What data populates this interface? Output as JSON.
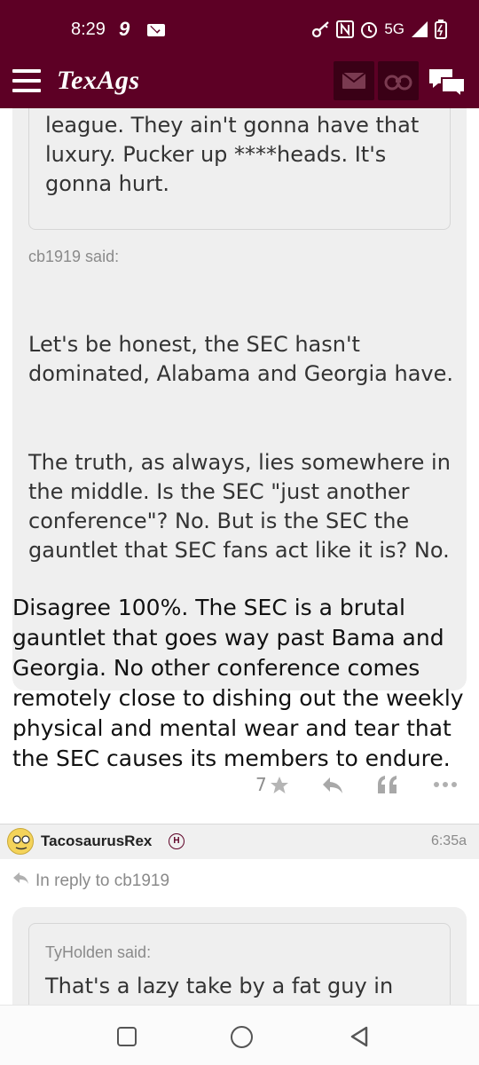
{
  "status_bar": {
    "time": "8:29",
    "notification_number": "9",
    "network": "5G",
    "icons": [
      "mail-icon",
      "key-icon",
      "nfc-icon",
      "alarm-icon",
      "signal-icon",
      "battery-icon"
    ]
  },
  "header": {
    "logo": "TexAgs",
    "icons": [
      "menu-icon",
      "mail-icon",
      "binoculars-icon",
      "chat-icon"
    ],
    "brand_color": "#5d0025"
  },
  "post1": {
    "nested_quote_text": "supporting him when we joined the league. They ain't gonna have that luxury. Pucker up ****heads. It's gonna hurt.",
    "quote_said": "cb1919 said:",
    "quote_para1": "Let's be honest, the SEC hasn't dominated, Alabama and Georgia have.",
    "quote_para2": "The truth, as always, lies somewhere in the middle. Is the SEC \"just another conference\"? No. But is the SEC the gauntlet that SEC fans act like it is? No.",
    "body": "Disagree 100%. The SEC is a brutal gauntlet that goes way past Bama and Georgia. No other conference comes remotely close to dishing out the weekly physical and mental wear and tear that the SEC causes its members to endure.",
    "like_count": "7",
    "actions": [
      "star-icon",
      "reply-icon",
      "quote-icon",
      "more-icon"
    ]
  },
  "post2": {
    "author": "TacosaurusRex",
    "badge": "H",
    "time": "6:35a",
    "in_reply_to": "In reply to cb1919",
    "quote_said": "TyHolden said:",
    "quote_text": "That's a lazy take by a fat guy in"
  },
  "navbar": {
    "buttons": [
      "recents-button",
      "home-button",
      "back-button"
    ]
  }
}
